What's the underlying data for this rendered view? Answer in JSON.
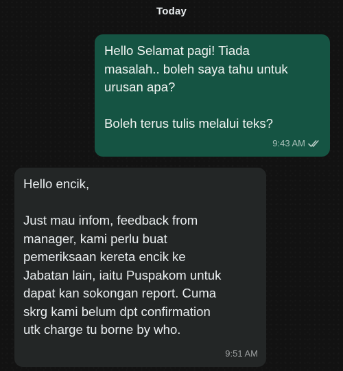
{
  "date_separator": "Today",
  "messages": [
    {
      "direction": "outgoing",
      "text": "Hello Selamat pagi! Tiada\nmasalah.. boleh saya tahu untuk\nurusan apa?\n\nBoleh terus tulis melalui teks?",
      "time": "9:43 AM",
      "status_icon": "double-check-icon"
    },
    {
      "direction": "incoming",
      "text": "Hello encik,\n\nJust mau infom, feedback from\nmanager, kami perlu buat\npemeriksaan kereta encik ke\nJabatan lain, iaitu Puspakom untuk\ndapat kan sokongan report. Cuma\nskrg kami belum dpt confirmation\nutk charge tu borne by who.",
      "time": "9:51 AM"
    }
  ],
  "colors": {
    "background": "#121212",
    "outgoing_bubble": "#155443",
    "incoming_bubble": "#232626",
    "text": "#e9edef"
  }
}
